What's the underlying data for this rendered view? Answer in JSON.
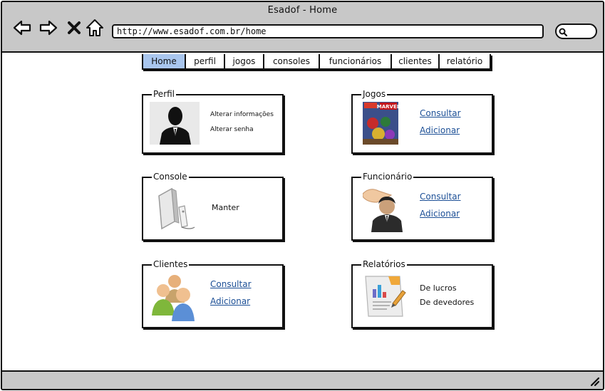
{
  "window": {
    "title": "Esadof - Home",
    "url": "http://www.esadof.com.br/home"
  },
  "toolbar": {
    "back_icon": "arrow-left-icon",
    "forward_icon": "arrow-right-icon",
    "stop_icon": "close-icon",
    "home_icon": "home-icon",
    "search_icon": "search-icon"
  },
  "tabs": [
    {
      "label": "Home",
      "active": true
    },
    {
      "label": "perfil"
    },
    {
      "label": "jogos"
    },
    {
      "label": "consoles"
    },
    {
      "label": "funcionários"
    },
    {
      "label": "clientes"
    },
    {
      "label": "relatório"
    }
  ],
  "cards": {
    "perfil": {
      "title": "Perfil",
      "line1": "Alterar informações",
      "line2": "Alterar senha"
    },
    "jogos": {
      "title": "Jogos",
      "link1": "Consultar",
      "link2": "Adicionar",
      "cover_label": "MARVEL"
    },
    "console": {
      "title": "Console",
      "line1": "Manter"
    },
    "funcionario": {
      "title": "Funcionário",
      "link1": "Consultar",
      "link2": "Adicionar"
    },
    "clientes": {
      "title": "Clientes",
      "link1": "Consultar",
      "link2": "Adicionar"
    },
    "relatorios": {
      "title": "Relatórios",
      "line1": "De lucros",
      "line2": "De devedores"
    }
  },
  "colors": {
    "chrome": "#c8c8c8",
    "active_tab": "#a9c6ee",
    "link": "#1c4f96"
  }
}
